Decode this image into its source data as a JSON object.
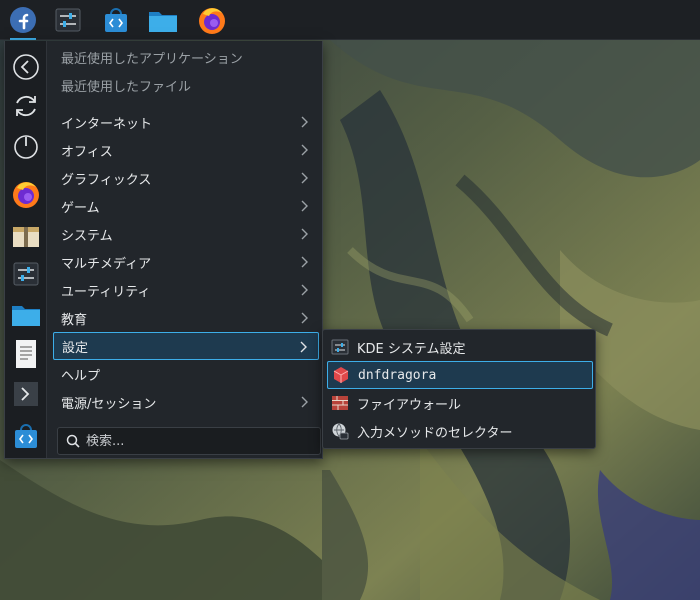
{
  "colors": {
    "accent": "#3daee9",
    "panel_bg": "#1d2024",
    "menu_bg": "#22262b",
    "selection_bg": "#1e3a4f"
  },
  "panel": {
    "items": [
      {
        "name": "application-launcher",
        "icon": "fedora-logo-icon"
      },
      {
        "name": "system-settings",
        "icon": "sliders-icon"
      },
      {
        "name": "software-store",
        "icon": "store-bag-icon"
      },
      {
        "name": "file-manager",
        "icon": "folder-icon"
      },
      {
        "name": "firefox",
        "icon": "firefox-icon"
      }
    ]
  },
  "favorites": [
    {
      "name": "back",
      "icon": "back-circle-icon"
    },
    {
      "name": "reboot",
      "icon": "reboot-icon"
    },
    {
      "name": "shutdown",
      "icon": "power-icon"
    },
    {
      "name": "firefox",
      "icon": "firefox-icon"
    },
    {
      "name": "archive",
      "icon": "archive-icon"
    },
    {
      "name": "settings",
      "icon": "sliders-icon"
    },
    {
      "name": "files",
      "icon": "folder-icon"
    },
    {
      "name": "document",
      "icon": "document-icon"
    },
    {
      "name": "terminal",
      "icon": "terminal-icon"
    },
    {
      "name": "store",
      "icon": "store-bag-icon"
    }
  ],
  "menu": {
    "items": [
      {
        "label": "最近使用したアプリケーション",
        "dim": true,
        "submenu": false
      },
      {
        "label": "最近使用したファイル",
        "dim": true,
        "submenu": false
      },
      {
        "label": "インターネット",
        "dim": false,
        "submenu": true
      },
      {
        "label": "オフィス",
        "dim": false,
        "submenu": true
      },
      {
        "label": "グラフィックス",
        "dim": false,
        "submenu": true
      },
      {
        "label": "ゲーム",
        "dim": false,
        "submenu": true
      },
      {
        "label": "システム",
        "dim": false,
        "submenu": true
      },
      {
        "label": "マルチメディア",
        "dim": false,
        "submenu": true
      },
      {
        "label": "ユーティリティ",
        "dim": false,
        "submenu": true
      },
      {
        "label": "教育",
        "dim": false,
        "submenu": true
      },
      {
        "label": "設定",
        "dim": false,
        "submenu": true,
        "selected": true
      },
      {
        "label": "ヘルプ",
        "dim": false,
        "submenu": false
      },
      {
        "label": "電源/セッション",
        "dim": false,
        "submenu": true
      }
    ],
    "search": {
      "placeholder": "検索..."
    }
  },
  "submenu": {
    "items": [
      {
        "label": "KDE システム設定",
        "icon": "kde-settings-icon"
      },
      {
        "label": "dnfdragora",
        "icon": "dnfdragora-icon",
        "selected": true
      },
      {
        "label": "ファイアウォール",
        "icon": "firewall-icon"
      },
      {
        "label": "入力メソッドのセレクター",
        "icon": "input-method-icon"
      }
    ]
  }
}
